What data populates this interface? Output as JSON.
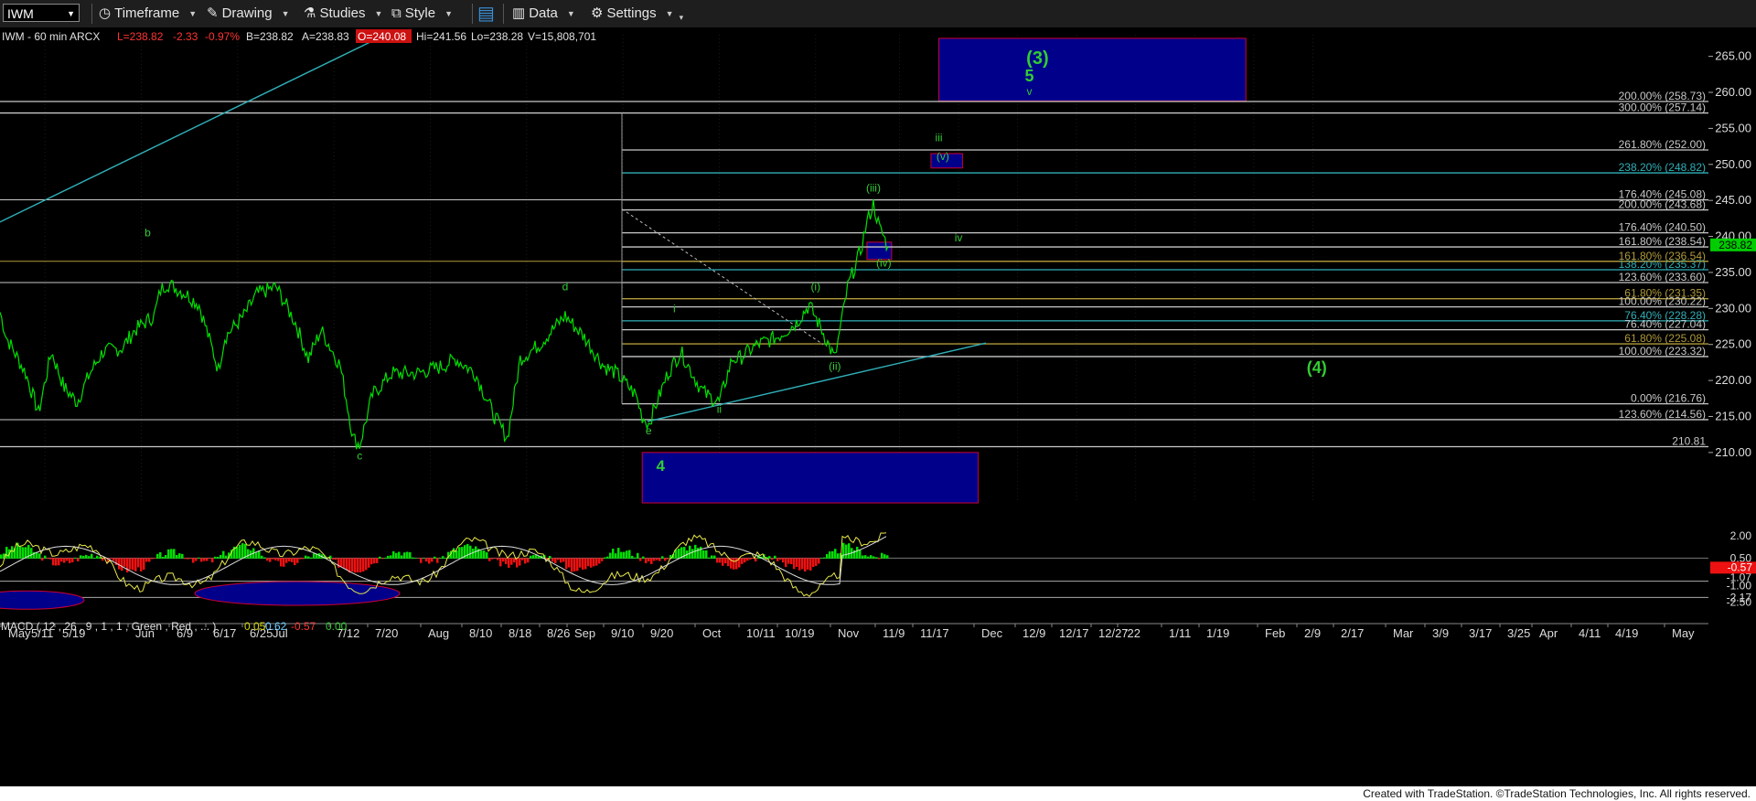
{
  "toolbar": {
    "symbol": "IWM",
    "timeframe": "Timeframe",
    "drawing": "Drawing",
    "studies": "Studies",
    "style": "Style",
    "data": "Data",
    "settings": "Settings"
  },
  "header": {
    "symbol_info": "IWM - 60 min  ARCX",
    "last": "L=238.82",
    "change": "-2.33",
    "change_pct": "-0.97%",
    "bid": "B=238.82",
    "ask": "A=238.83",
    "open": "O=240.08",
    "high": "Hi=241.56",
    "low": "Lo=238.28",
    "volume": "V=15,808,701"
  },
  "macd_header": {
    "label": "MACD ( 12 , 26 , 9 , 1 , 1 , Green , Red , ... )",
    "v1": "0.05",
    "v2": "0.62",
    "v3": "-0.57",
    "v4": "0.00"
  },
  "footer": "Created with TradeStation. ©TradeStation Technologies, Inc. All rights reserved.",
  "colors": {
    "price": "#00e000",
    "zone_fill": "#00008b",
    "zone_border": "#cc0033",
    "level_white": "#c8c8c8",
    "level_gold": "#b09a3a",
    "level_teal": "#2fb0b8",
    "trendline": "#2fb0b8",
    "wave_label": "#33cc33",
    "macd_up": "#00e000",
    "macd_down": "#ee1111"
  },
  "chart_data": {
    "type": "line",
    "symbol": "IWM",
    "interval": "60 min",
    "ylim": [
      203,
      268
    ],
    "y_ticks": [
      210,
      215,
      220,
      225,
      230,
      235,
      240,
      245,
      250,
      255,
      260,
      265
    ],
    "last_price": 238.82,
    "x_tick_labels": [
      "May",
      "5/11",
      "5/19",
      "Jun",
      "6/9",
      "6/17",
      "6/25",
      "Jul",
      "7/12",
      "7/20",
      "Aug",
      "8/10",
      "8/18",
      "8/26",
      "Sep",
      "9/10",
      "9/20",
      "Oct",
      "10/11",
      "10/19",
      "Nov",
      "11/9",
      "11/17",
      "Dec",
      "12/9",
      "12/17",
      "12/27",
      "'22",
      "1/11",
      "1/19",
      "Feb",
      "2/9",
      "2/17",
      "Mar",
      "3/9",
      "3/17",
      "3/25",
      "Apr",
      "4/11",
      "4/19",
      "May"
    ],
    "price_series": [
      [
        "5/1",
        229.5
      ],
      [
        "5/4",
        226
      ],
      [
        "5/7",
        221
      ],
      [
        "5/11",
        215.5
      ],
      [
        "5/13",
        224
      ],
      [
        "5/17",
        219
      ],
      [
        "5/19",
        217
      ],
      [
        "5/21",
        221
      ],
      [
        "5/25",
        224
      ],
      [
        "5/28",
        224.5
      ],
      [
        "6/1",
        227
      ],
      [
        "6/4",
        229
      ],
      [
        "6/7",
        232.5
      ],
      [
        "6/8",
        233.5
      ],
      [
        "6/11",
        232
      ],
      [
        "6/15",
        230.5
      ],
      [
        "6/18",
        221.5
      ],
      [
        "6/21",
        226
      ],
      [
        "6/24",
        229
      ],
      [
        "6/28",
        232
      ],
      [
        "7/1",
        233
      ],
      [
        "7/6",
        228
      ],
      [
        "7/8",
        223
      ],
      [
        "7/12",
        227
      ],
      [
        "7/15",
        222
      ],
      [
        "7/19",
        212
      ],
      [
        "7/20",
        211
      ],
      [
        "7/22",
        218
      ],
      [
        "7/27",
        221
      ],
      [
        "7/30",
        221
      ],
      [
        "8/2",
        221
      ],
      [
        "8/6",
        222
      ],
      [
        "8/10",
        223
      ],
      [
        "8/13",
        221
      ],
      [
        "8/18",
        215
      ],
      [
        "8/20",
        212
      ],
      [
        "8/24",
        223
      ],
      [
        "8/27",
        225
      ],
      [
        "8/31",
        227
      ],
      [
        "9/2",
        229
      ],
      [
        "9/7",
        226
      ],
      [
        "9/10",
        222
      ],
      [
        "9/14",
        221
      ],
      [
        "9/17",
        218
      ],
      [
        "9/20",
        215
      ],
      [
        "9/21",
        214
      ],
      [
        "9/24",
        221
      ],
      [
        "9/28",
        224
      ],
      [
        "10/1",
        219
      ],
      [
        "10/4",
        218
      ],
      [
        "10/6",
        217
      ],
      [
        "10/8",
        223
      ],
      [
        "10/11",
        223
      ],
      [
        "10/14",
        225
      ],
      [
        "10/19",
        226
      ],
      [
        "10/22",
        228
      ],
      [
        "10/26",
        230.5
      ],
      [
        "10/28",
        227
      ],
      [
        "11/1",
        223
      ],
      [
        "11/2",
        228
      ],
      [
        "11/3",
        233
      ],
      [
        "11/5",
        238
      ],
      [
        "11/8",
        242
      ],
      [
        "11/9",
        244.5
      ],
      [
        "11/10",
        241
      ],
      [
        "11/11",
        240
      ],
      [
        "11/12",
        238.5
      ]
    ],
    "fib_levels": [
      {
        "label": "200.00% (258.73)",
        "value": 258.73,
        "color": "white"
      },
      {
        "label": "300.00% (257.14)",
        "value": 257.14,
        "color": "white"
      },
      {
        "label": "261.80% (252.00)",
        "value": 252.0,
        "color": "white"
      },
      {
        "label": "238.20% (248.82)",
        "value": 248.82,
        "color": "teal"
      },
      {
        "label": "176.40% (245.08)",
        "value": 245.08,
        "color": "white"
      },
      {
        "label": "200.00% (243.68)",
        "value": 243.68,
        "color": "white"
      },
      {
        "label": "176.40% (240.50)",
        "value": 240.5,
        "color": "white"
      },
      {
        "label": "161.80% (238.54)",
        "value": 238.54,
        "color": "white"
      },
      {
        "label": "161.80% (236.54)",
        "value": 236.54,
        "color": "gold"
      },
      {
        "label": "138.20% (235.37)",
        "value": 235.37,
        "color": "teal"
      },
      {
        "label": "123.60% (233.60)",
        "value": 233.6,
        "color": "white"
      },
      {
        "label": "61.80% (231.35)",
        "value": 231.35,
        "color": "gold"
      },
      {
        "label": "100.00% (230.22)",
        "value": 230.22,
        "color": "white"
      },
      {
        "label": "76.40% (228.28)",
        "value": 228.28,
        "color": "teal"
      },
      {
        "label": "76.40% (227.04)",
        "value": 227.04,
        "color": "white"
      },
      {
        "label": "61.80% (225.08)",
        "value": 225.08,
        "color": "gold"
      },
      {
        "label": "100.00% (223.32)",
        "value": 223.32,
        "color": "white"
      },
      {
        "label": "0.00% (216.76)",
        "value": 216.76,
        "color": "white"
      },
      {
        "label": "123.60% (214.56)",
        "value": 214.56,
        "color": "white"
      },
      {
        "label": "210.81",
        "value": 210.81,
        "color": "white"
      }
    ],
    "zones": [
      {
        "label": "(3)",
        "x": [
          "12/1",
          "3/21"
        ],
        "y": [
          258.8,
          267.5
        ]
      },
      {
        "label": "",
        "x": [
          "11/29",
          "12/9"
        ],
        "y": [
          249.5,
          251.5
        ]
      },
      {
        "label": "",
        "x": [
          "11/8",
          "11/13"
        ],
        "y": [
          236.8,
          239.2
        ]
      },
      {
        "label": "4",
        "x": [
          "9/20",
          "12/15"
        ],
        "y": [
          203,
          210
        ]
      }
    ],
    "wave_labels": [
      {
        "text": "b",
        "date": "6/3",
        "value": 240
      },
      {
        "text": "c",
        "date": "7/20",
        "value": 209
      },
      {
        "text": "d",
        "date": "9/2",
        "value": 232.5
      },
      {
        "text": "e",
        "date": "9/21",
        "value": 212.5
      },
      {
        "text": "i",
        "date": "9/26",
        "value": 229.5
      },
      {
        "text": "ii",
        "date": "10/6",
        "value": 215.5
      },
      {
        "text": "(i)",
        "date": "10/27",
        "value": 232.5
      },
      {
        "text": "(ii)",
        "date": "11/1",
        "value": 221.5
      },
      {
        "text": "(iii)",
        "date": "11/9",
        "value": 246.2
      },
      {
        "text": "(iv)",
        "date": "11/11",
        "value": 235.8
      },
      {
        "text": "(v)",
        "date": "12/2",
        "value": 250.6
      },
      {
        "text": "iii",
        "date": "12/1",
        "value": 253.2
      },
      {
        "text": "iv",
        "date": "12/8",
        "value": 239.3
      },
      {
        "text": "5",
        "date": "1/2",
        "value": 261.5
      },
      {
        "text": "v",
        "date": "1/2",
        "value": 259.6
      },
      {
        "text": "(4)",
        "date": "4/14",
        "value": 221
      }
    ],
    "macd": {
      "ylim": [
        -3.2,
        3.0
      ],
      "ticks": [
        "2.00",
        "0.50",
        "-1.07",
        "-1.00",
        "-2.17",
        "-2.50"
      ],
      "readout": {
        "value": "-0.57"
      }
    }
  }
}
